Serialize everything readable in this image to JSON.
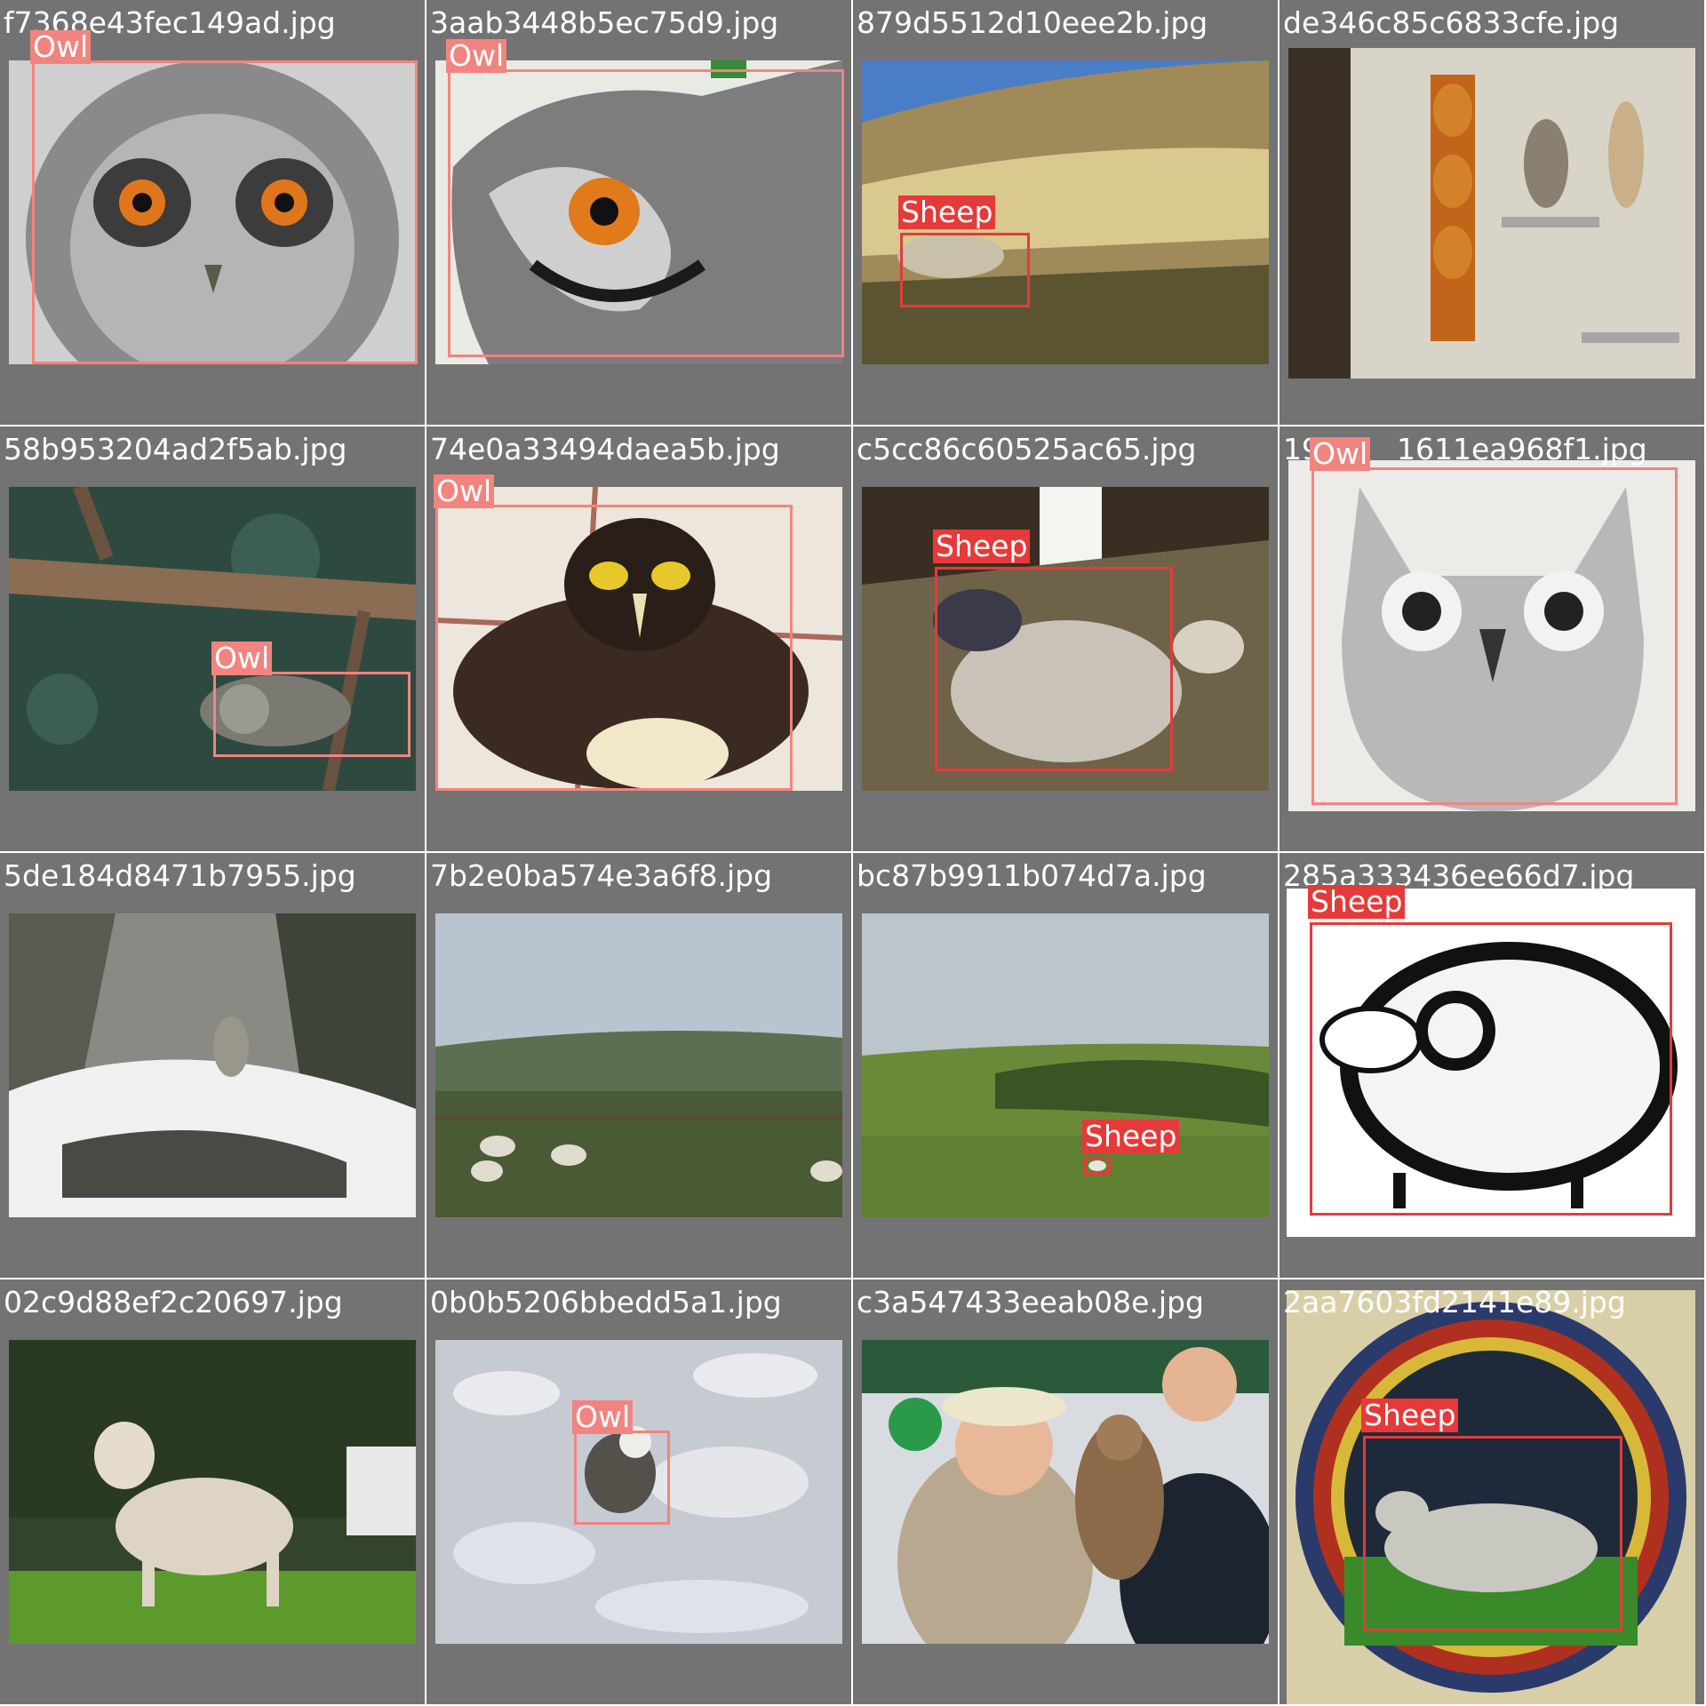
{
  "colors": {
    "owl": "#f2847f",
    "sheep": "#e63a3a",
    "cell_bg": "#737373"
  },
  "grid": [
    {
      "filename": "f7368e43fec149ad.jpg",
      "image": "owl-closeup-photo",
      "boxes": [
        {
          "label": "Owl"
        }
      ]
    },
    {
      "filename": "3aab3448b5ec75d9.jpg",
      "image": "owl-side-photo",
      "boxes": [
        {
          "label": "Owl"
        }
      ]
    },
    {
      "filename": "879d5512d10eee2b.jpg",
      "image": "hillside-sheep-photo",
      "boxes": [
        {
          "label": "Sheep"
        }
      ]
    },
    {
      "filename": "de346c85c6833cfe.jpg",
      "image": "carved-figures-shelf-photo",
      "boxes": []
    },
    {
      "filename": "58b953204ad2f5ab.jpg",
      "image": "owl-in-branches-photo",
      "boxes": [
        {
          "label": "Owl"
        }
      ]
    },
    {
      "filename": "74e0a33494daea5b.jpg",
      "image": "spectacled-owl-photo",
      "boxes": [
        {
          "label": "Owl"
        }
      ]
    },
    {
      "filename": "c5cc86c60525ac65.jpg",
      "image": "barn-sheep-photo",
      "boxes": [
        {
          "label": "Sheep"
        }
      ]
    },
    {
      "filename": "1611ea968f1.jpg",
      "filename_prefix": "19",
      "image": "owl-sketch",
      "boxes": [
        {
          "label": "Owl"
        }
      ]
    },
    {
      "filename": "5de184d8471b7955.jpg",
      "image": "snowy-owl-forest-photo",
      "boxes": []
    },
    {
      "filename": "7b2e0ba574e3a6f8.jpg",
      "image": "pasture-sheep-photo",
      "boxes": []
    },
    {
      "filename": "bc87b9911b074d7a.jpg",
      "image": "green-field-sheep-photo",
      "boxes": [
        {
          "label": "Sheep"
        }
      ]
    },
    {
      "filename": "285a333436ee66d7.jpg",
      "image": "sheep-cartoon",
      "boxes": [
        {
          "label": "Sheep"
        }
      ]
    },
    {
      "filename": "02c9d88ef2c20697.jpg",
      "image": "lamb-photo",
      "boxes": []
    },
    {
      "filename": "0b0b5206bbedd5a1.jpg",
      "image": "snowy-owl-ice-photo",
      "boxes": [
        {
          "label": "Owl"
        }
      ]
    },
    {
      "filename": "c3a547433eeab08e.jpg",
      "image": "people-with-owl-photo",
      "boxes": []
    },
    {
      "filename": "2aa7603fd2141e89.jpg",
      "image": "medieval-sheep-illumination",
      "boxes": [
        {
          "label": "Sheep"
        }
      ]
    }
  ]
}
